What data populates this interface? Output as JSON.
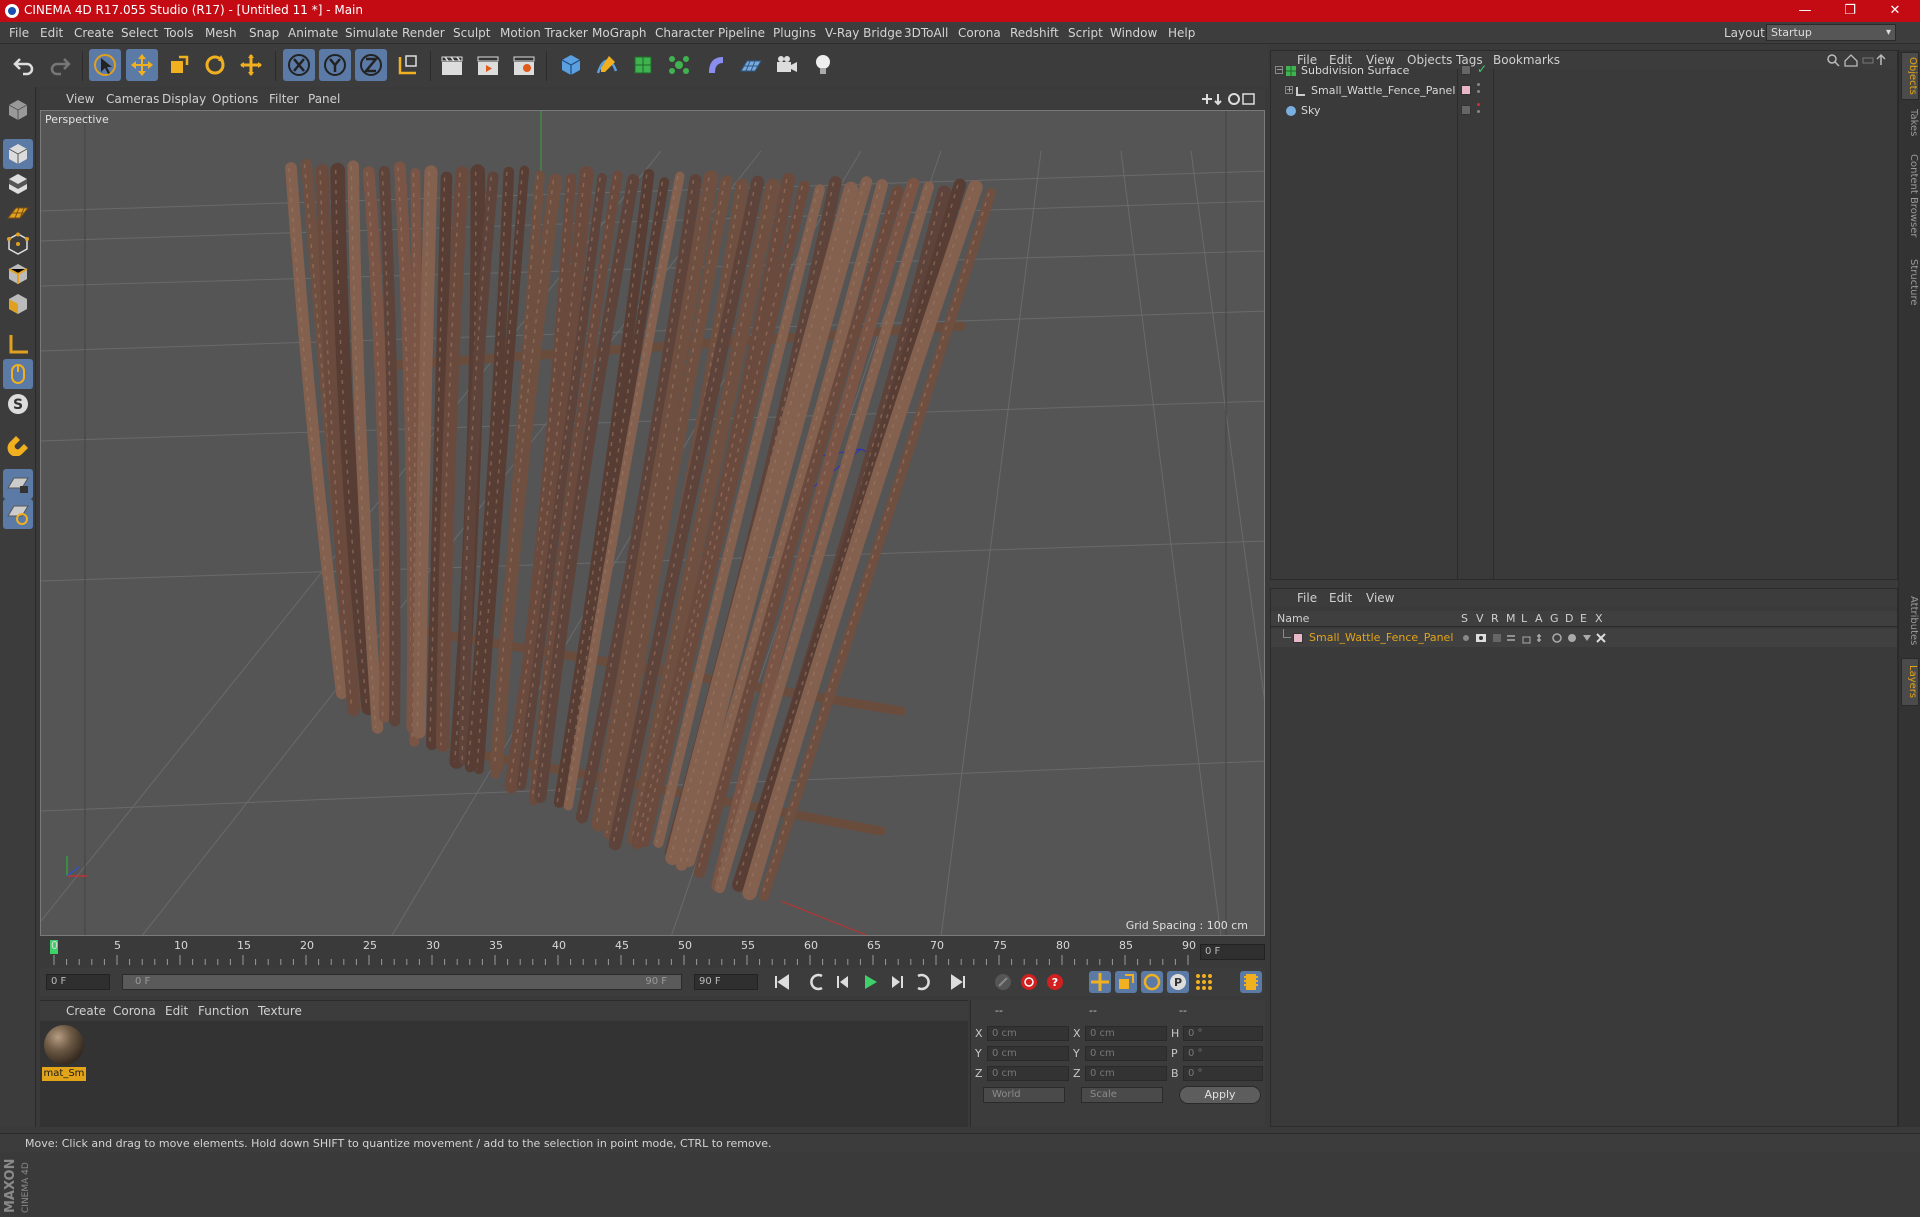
{
  "window": {
    "title": "CINEMA 4D R17.055 Studio (R17) - [Untitled 11 *] - Main",
    "minimize": "—",
    "maximize": "❐",
    "close": "✕"
  },
  "menu": [
    "File",
    "Edit",
    "Create",
    "Select",
    "Tools",
    "Mesh",
    "Snap",
    "Animate",
    "Simulate",
    "Render",
    "Sculpt",
    "Motion Tracker",
    "MoGraph",
    "Character",
    "Pipeline",
    "Plugins",
    "V-Ray Bridge",
    "3DToAll",
    "Corona",
    "Redshift",
    "Script",
    "Window",
    "Help"
  ],
  "layout": {
    "label": "Layout:",
    "value": "Startup"
  },
  "viewport": {
    "menu": [
      "View",
      "Cameras",
      "Display",
      "Options",
      "Filter",
      "Panel"
    ],
    "label": "Perspective",
    "grid_spacing": "Grid Spacing : 100 cm"
  },
  "timeline": {
    "ticks": [
      "0",
      "5",
      "10",
      "15",
      "20",
      "25",
      "30",
      "35",
      "40",
      "45",
      "50",
      "55",
      "60",
      "65",
      "70",
      "75",
      "80",
      "85",
      "90"
    ],
    "current_frame": "0 F"
  },
  "transport": {
    "start": "0 F",
    "range_start": "0 F",
    "range_end": "90 F",
    "end": "90 F"
  },
  "materials": {
    "menu": [
      "Create",
      "Corona",
      "Edit",
      "Function",
      "Texture"
    ],
    "items": [
      {
        "name": "mat_Sm"
      }
    ]
  },
  "coordinates": {
    "headers": [
      "--",
      "--",
      "--"
    ],
    "rows": [
      {
        "a": "X",
        "v1": "0 cm",
        "b": "X",
        "v2": "0 cm",
        "c": "H",
        "v3": "0 °"
      },
      {
        "a": "Y",
        "v1": "0 cm",
        "b": "Y",
        "v2": "0 cm",
        "c": "P",
        "v3": "0 °"
      },
      {
        "a": "Z",
        "v1": "0 cm",
        "b": "Z",
        "v2": "0 cm",
        "c": "B",
        "v3": "0 °"
      }
    ],
    "mode": "World",
    "size_mode": "Scale",
    "apply": "Apply"
  },
  "status": "Move: Click and drag to move elements. Hold down SHIFT to quantize movement / add to the selection in point mode, CTRL to remove.",
  "objects": {
    "menu": [
      "File",
      "Edit",
      "View",
      "Objects",
      "Tags",
      "Bookmarks"
    ],
    "items": [
      {
        "name": "Subdivision Surface"
      },
      {
        "name": "Small_Wattle_Fence_Panel"
      },
      {
        "name": "Sky"
      }
    ]
  },
  "layers": {
    "menu": [
      "File",
      "Edit",
      "View"
    ],
    "columns": [
      "Name",
      "S",
      "V",
      "R",
      "M",
      "L",
      "A",
      "G",
      "D",
      "E",
      "X"
    ],
    "items": [
      {
        "name": "Small_Wattle_Fence_Panel"
      }
    ]
  },
  "side_tabs": [
    "Objects",
    "Takes",
    "Content Browser",
    "Structure",
    "Attributes",
    "Layers"
  ],
  "colors": {
    "accent": "#e2a418",
    "titlebar": "#c40b14",
    "selected": "#5c7aa6"
  }
}
